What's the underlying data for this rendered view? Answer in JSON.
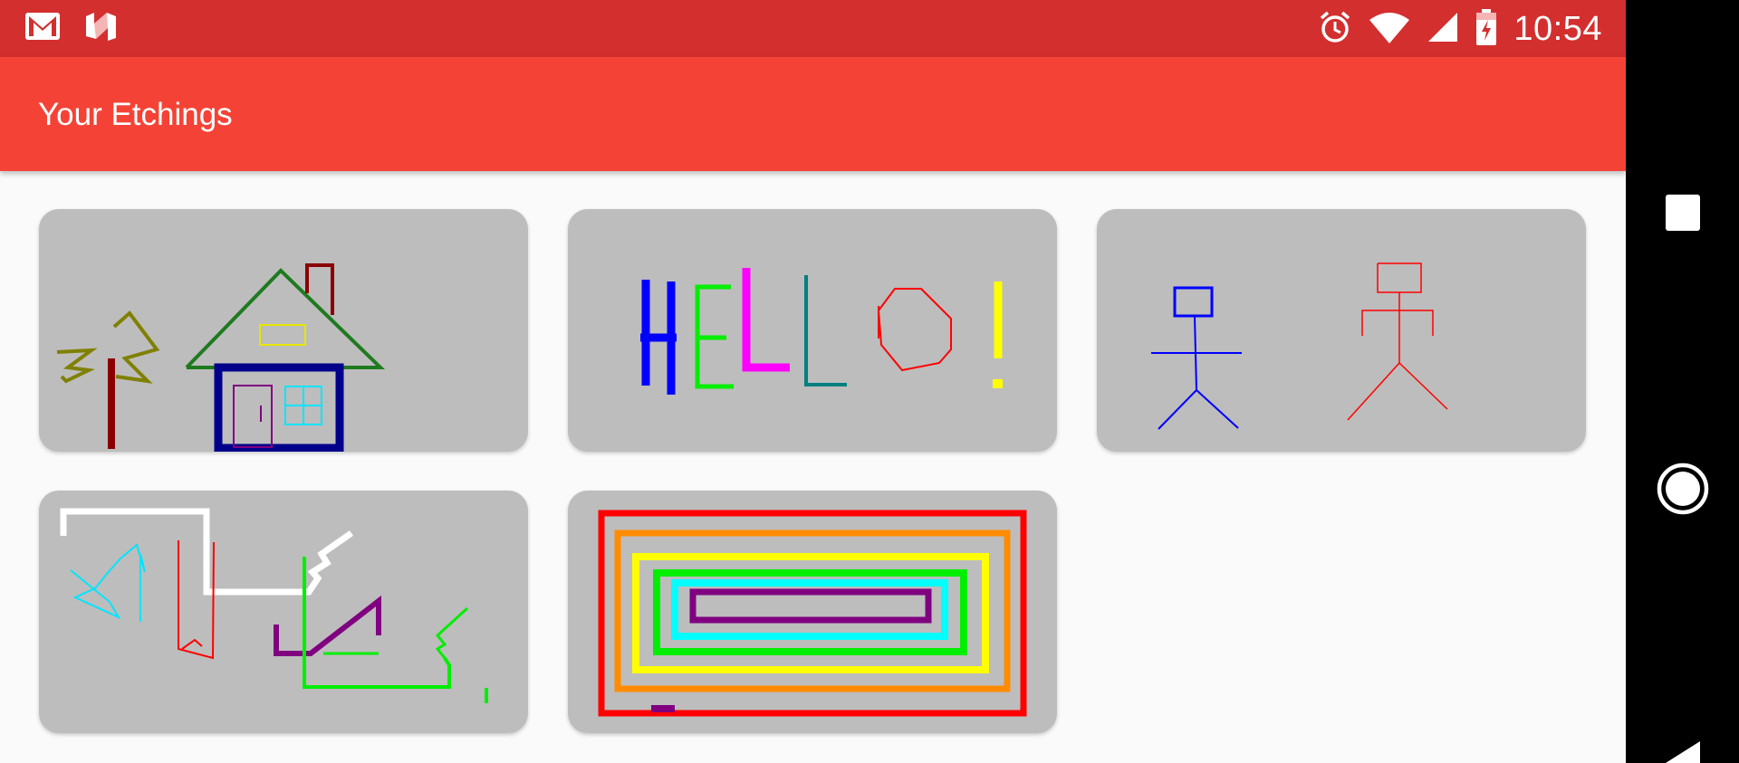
{
  "status_bar": {
    "time": "10:54",
    "left_icons": [
      "gmail-icon",
      "n-notification-icon"
    ],
    "right_icons": [
      "alarm-icon",
      "wifi-icon",
      "cell-signal-icon",
      "battery-charging-icon"
    ]
  },
  "app_bar": {
    "title": "Your Etchings"
  },
  "etchings": [
    {
      "name": "house-and-tree-etching"
    },
    {
      "name": "hello-text-etching"
    },
    {
      "name": "stick-figures-etching"
    },
    {
      "name": "abstract-lines-etching"
    },
    {
      "name": "nested-rectangles-etching"
    }
  ],
  "nav_bar": {
    "buttons": [
      "recents-icon",
      "home-icon",
      "back-icon"
    ]
  },
  "colors": {
    "status_bar": "#d32f2f",
    "app_bar": "#f44336",
    "background": "#fafafa",
    "card": "#bdbdbd"
  }
}
